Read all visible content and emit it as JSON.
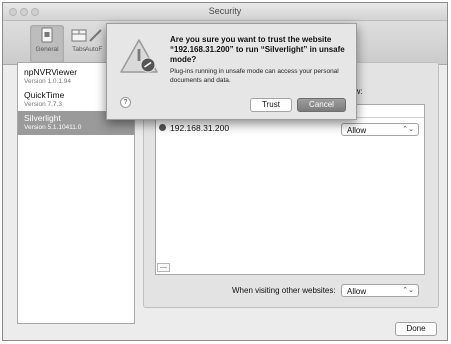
{
  "window": {
    "title": "Security"
  },
  "toolbar": {
    "items": [
      {
        "label": "General",
        "icon": "general-icon"
      },
      {
        "label": "Tabs",
        "icon": "tabs-icon"
      },
      {
        "label": "AutoF",
        "icon": "autofill-icon"
      }
    ]
  },
  "plugins": [
    {
      "name": "npNVRViewer",
      "version": "Version 1.0.1.94"
    },
    {
      "name": "QuickTime",
      "version": "Version 7.7.3"
    },
    {
      "name": "Silverlight",
      "version": "Version 5.1.10411.0"
    }
  ],
  "main": {
    "header_partial": "ow:",
    "site": {
      "url": "192.168.31.200",
      "permission": "Allow"
    },
    "remove_label": "—",
    "other_websites_label": "When visiting other websites:",
    "other_websites_value": "Allow",
    "done_label": "Done"
  },
  "dialog": {
    "title": "Are you sure you want to trust the website “192.168.31.200” to run “Silverlight” in unsafe mode?",
    "message": "Plug-ins running in unsafe mode can access your personal documents and data.",
    "help_label": "?",
    "trust_label": "Trust",
    "cancel_label": "Cancel"
  }
}
